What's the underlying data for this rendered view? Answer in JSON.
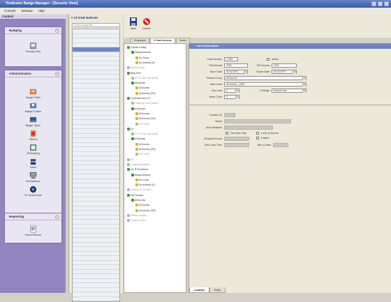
{
  "window": {
    "title": "Vindicator Badge Manager - [Security View]"
  },
  "menu": [
    "Console",
    "Window",
    "Help"
  ],
  "control_panel": {
    "header": "Control",
    "sections": [
      {
        "title": "Badging",
        "items": [
          {
            "label": "Security View",
            "icon": "security-view-icon"
          }
        ]
      },
      {
        "title": "Administration",
        "items": [
          {
            "label": "Badge Fields",
            "icon": "badge-fields-icon"
          },
          {
            "label": "Badge Profiles",
            "icon": "badge-profiles-icon"
          },
          {
            "label": "Badge Types",
            "icon": "badge-types-icon"
          },
          {
            "label": "Filtered",
            "icon": "filtered-icon"
          },
          {
            "label": "DB Auditing",
            "icon": "db-auditing-icon"
          },
          {
            "label": "Users",
            "icon": "users-icon"
          },
          {
            "label": "Workstations",
            "icon": "workstations-icon"
          },
          {
            "label": "VS Synchronize",
            "icon": "vs-synchronize-icon"
          }
        ]
      },
      {
        "title": "Reporting",
        "items": [
          {
            "label": "Report Wizard",
            "icon": "report-wizard-icon"
          }
        ]
      }
    ]
  },
  "badge_list": {
    "title": "# of ICSR Refresh",
    "search_placeholder": "Search badge list",
    "rows": [
      "",
      "",
      "",
      "",
      "",
      "",
      "",
      "",
      "",
      "",
      "",
      "",
      "",
      "",
      "",
      "",
      "",
      "",
      "",
      "",
      "",
      "",
      "",
      "",
      "",
      "",
      "",
      "",
      "",
      "",
      "",
      "",
      "",
      "",
      "",
      "",
      "",
      "",
      "",
      "",
      "",
      "",
      "",
      "",
      "",
      "",
      "",
      "",
      "",
      "",
      "",
      "",
      "",
      "",
      "",
      "",
      "",
      "",
      "",
      ""
    ],
    "selected_index": 4
  },
  "toolbar": {
    "save_label": "Save",
    "cancel_label": "Cancel"
  },
  "tabs": [
    {
      "label": "Employee",
      "active": false
    },
    {
      "label": "2 Card Access",
      "active": true
    },
    {
      "label": "Notes",
      "active": false
    }
  ],
  "tree": [
    {
      "depth": 0,
      "label": "Outside Facility",
      "dim": false,
      "color": "#4a9a3a"
    },
    {
      "depth": 1,
      "label": "Always Allowed",
      "dim": false,
      "color": "#3a8a3a"
    },
    {
      "depth": 2,
      "label": "No Group",
      "dim": false,
      "color": "#e0b020"
    },
    {
      "depth": 2,
      "label": "No authority (0)",
      "dim": false,
      "color": "#e0b020"
    },
    {
      "depth": 0,
      "label": "Building (bus)",
      "dim": true,
      "color": "#b0b0b0"
    },
    {
      "depth": 0,
      "label": "Bldg 2000",
      "dim": false,
      "color": "#4a9a3a"
    },
    {
      "depth": 1,
      "label": "CCTV Top Level (Built)",
      "dim": true,
      "color": "#b0b0b0"
    },
    {
      "depth": 1,
      "label": "All Access",
      "dim": false,
      "color": "#3a8a3a"
    },
    {
      "depth": 2,
      "label": "All Access",
      "dim": false,
      "color": "#e0b020"
    },
    {
      "depth": 2,
      "label": "All Access (200)",
      "dim": false,
      "color": "#e0b020"
    },
    {
      "depth": 0,
      "label": "Controlled Area C3",
      "dim": false,
      "color": "#4a9a3a"
    },
    {
      "depth": 1,
      "label": "Outgoing Level (active)",
      "dim": true,
      "color": "#b0b0b0"
    },
    {
      "depth": 1,
      "label": "All Access",
      "dim": false,
      "color": "#3a8a3a"
    },
    {
      "depth": 2,
      "label": "All Access",
      "dim": false,
      "color": "#e0b020"
    },
    {
      "depth": 2,
      "label": "All Access (200)",
      "dim": false,
      "color": "#e0b020"
    },
    {
      "depth": 2,
      "label": "VISITORS",
      "dim": true,
      "color": "#b0b0b0"
    },
    {
      "depth": 0,
      "label": "Int",
      "dim": false,
      "color": "#4a9a3a"
    },
    {
      "depth": 1,
      "label": "CCTV Top Level (Built)",
      "dim": true,
      "color": "#b0b0b0"
    },
    {
      "depth": 1,
      "label": "All Access",
      "dim": false,
      "color": "#3a8a3a"
    },
    {
      "depth": 2,
      "label": "All Access",
      "dim": false,
      "color": "#e0b020"
    },
    {
      "depth": 2,
      "label": "All Access (200)",
      "dim": false,
      "color": "#e0b020"
    },
    {
      "depth": 2,
      "label": "VISITORS",
      "dim": true,
      "color": "#b0b0b0"
    },
    {
      "depth": 0,
      "label": "Int",
      "dim": true,
      "color": "#b0b0b0"
    },
    {
      "depth": 0,
      "label": "Locations/Location",
      "dim": true,
      "color": "#b0b0b0"
    },
    {
      "depth": 0,
      "label": "C/L R Enrollment",
      "dim": false,
      "color": "#4a9a3a"
    },
    {
      "depth": 1,
      "label": "Always Allowed",
      "dim": false,
      "color": "#3a8a3a"
    },
    {
      "depth": 2,
      "label": "No Group",
      "dim": false,
      "color": "#e0b020"
    },
    {
      "depth": 2,
      "label": "No authority (0)",
      "dim": false,
      "color": "#e0b020"
    },
    {
      "depth": 0,
      "label": "Parking Lot Location",
      "dim": true,
      "color": "#b0b0b0"
    },
    {
      "depth": 0,
      "label": "Test location",
      "dim": false,
      "color": "#4a9a3a"
    },
    {
      "depth": 1,
      "label": "All Access",
      "dim": false,
      "color": "#3a8a3a"
    },
    {
      "depth": 2,
      "label": "All Access",
      "dim": false,
      "color": "#e0b020"
    },
    {
      "depth": 2,
      "label": "All Access (200)",
      "dim": false,
      "color": "#e0b020"
    },
    {
      "depth": 0,
      "label": "Tested Location",
      "dim": true,
      "color": "#b0b0b0"
    },
    {
      "depth": 0,
      "label": "Vivarium Open",
      "dim": true,
      "color": "#b0b0b0"
    }
  ],
  "card_info": {
    "title": "Card Information",
    "card_number_label": "Card Number",
    "card_number": "17626",
    "active_label": "Active",
    "pin_normal_label": "PIN Normal",
    "pin_normal": "1000",
    "pin_duress_label": "PIN Duress",
    "pin_duress": "1126",
    "issue_date_label": "Issue Date",
    "issue_date": "01/01/1970",
    "expire_date_label": "Expire Date",
    "expire_date": "01/22/1970",
    "person_group_label": "Person Group",
    "person_group": "All Access",
    "auth_level_label": "Auth Level",
    "auth_level": "All Access - (200)",
    "use_limit_label": "Use Limit",
    "use_limit": "0",
    "privilege_label": "Privilege",
    "privilege": "Normal User",
    "issue_code_label": "Issue Code",
    "issue_code": "0"
  },
  "location_info": {
    "location_id_label": "Location ID",
    "name_label": "Name",
    "anti_passback_label": "Anti-Passback",
    "two_man_only_label": "Two Man Only",
    "lock_on_duress_label": "Lock on Duress",
    "required_escort_label": "Required Escort",
    "hosted_label": "Hosted",
    "max_later_time_label": "Max Later Time",
    "min_cards_label": "Min # Cards"
  },
  "bottom_tabs": [
    {
      "label": "Location",
      "active": true
    },
    {
      "label": "Roles",
      "active": false
    }
  ]
}
